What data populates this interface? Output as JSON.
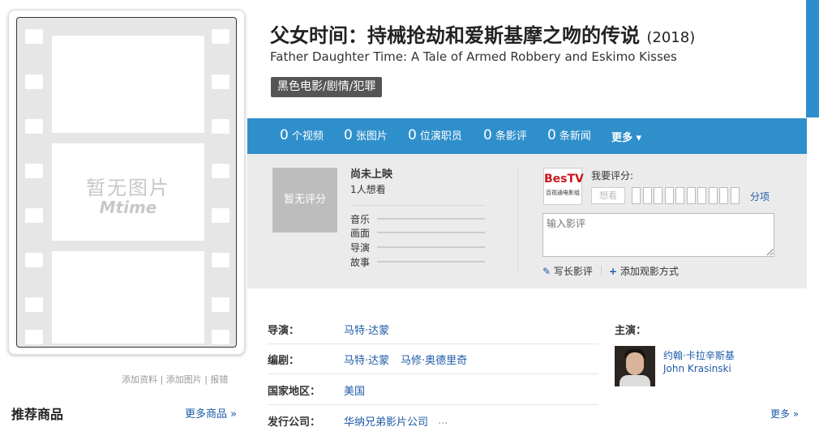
{
  "poster": {
    "placeholder_text": "暂无图片",
    "logo_text": "Mtime",
    "links": "添加资料 | 添加图片 | 报错"
  },
  "recommend": {
    "title": "推荐商品",
    "more": "更多商品 »"
  },
  "movie": {
    "title_cn": "父女时间：持械抢劫和爱斯基摩之吻的传说",
    "year": "(2018)",
    "title_en": "Father Daughter Time: A Tale of Armed Robbery and Eskimo Kisses",
    "genre": "黑色电影/剧情/犯罪"
  },
  "stats": {
    "videos": {
      "num": "0",
      "label": "个视频"
    },
    "images": {
      "num": "0",
      "label": "张图片"
    },
    "cast": {
      "num": "0",
      "label": "位演职员"
    },
    "reviews": {
      "num": "0",
      "label": "条影评"
    },
    "news": {
      "num": "0",
      "label": "条新闻"
    },
    "more": "更多 ▾"
  },
  "rating": {
    "no_score": "暂无评分",
    "release_status": "尚未上映",
    "want_count": "1人想看",
    "subs": [
      "音乐",
      "画面",
      "导演",
      "故事"
    ],
    "bestv_logo": "BesTV",
    "bestv_sub": "百视通电影组",
    "my_rating_label": "我要评分:",
    "want_button": "想看",
    "score_link": "分项",
    "review_placeholder": "输入影评",
    "write_long": "写长影评",
    "add_watch": "添加观影方式"
  },
  "info": {
    "director_label": "导演：",
    "director": "马特·达蒙",
    "writer_label": "编剧：",
    "writer_1": "马特·达蒙",
    "writer_2": "马修·奥德里奇",
    "country_label": "国家地区：",
    "country": "美国",
    "distributor_label": "发行公司：",
    "distributor": "华纳兄弟影片公司",
    "distributor_more": "..."
  },
  "cast": {
    "label": "主演：",
    "actor_cn": "约翰·卡拉辛斯基",
    "actor_en": "John Krasinski",
    "more": "更多 »"
  },
  "colors": {
    "accent": "#2f8fcb",
    "link": "#1e5ba8",
    "genre_bg": "#555555",
    "panel_bg": "#ebebeb"
  }
}
